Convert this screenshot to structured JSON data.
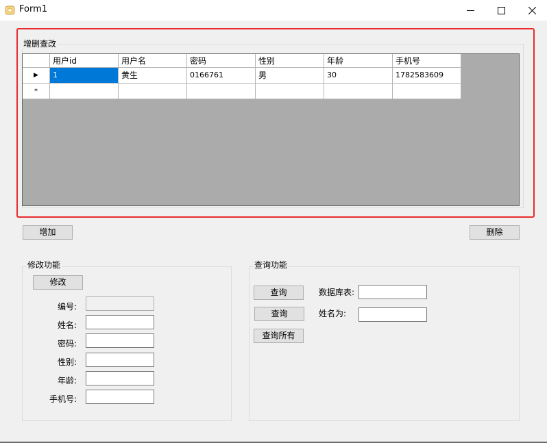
{
  "window": {
    "title": "Form1",
    "minimize_glyph": "—",
    "maximize_glyph": "☐",
    "close_glyph": "✕"
  },
  "crud_group": {
    "title": "增删查改",
    "columns": [
      "用户id",
      "用户名",
      "密码",
      "性别",
      "年龄",
      "手机号"
    ],
    "rows": [
      [
        "1",
        "黄生",
        "0166761",
        "男",
        "30",
        "1782583609"
      ]
    ],
    "current_row_marker": "▶",
    "new_row_marker": "*"
  },
  "actions": {
    "add_label": "增加",
    "delete_label": "删除"
  },
  "modify_group": {
    "title": "修改功能",
    "modify_label": "修改",
    "fields": [
      {
        "label": "编号:",
        "value": ""
      },
      {
        "label": "姓名:",
        "value": ""
      },
      {
        "label": "密码:",
        "value": ""
      },
      {
        "label": "性别:",
        "value": ""
      },
      {
        "label": "年龄:",
        "value": ""
      },
      {
        "label": "手机号:",
        "value": ""
      }
    ]
  },
  "query_group": {
    "title": "查询功能",
    "query_label": "查询",
    "query_all_label": "查询所有",
    "table_label": "数据库表:",
    "name_label": "姓名为:",
    "table_value": "",
    "name_value": ""
  },
  "colors": {
    "highlight": "#ea2b2b",
    "selection": "#0078d7",
    "grid_background": "#ababab"
  }
}
